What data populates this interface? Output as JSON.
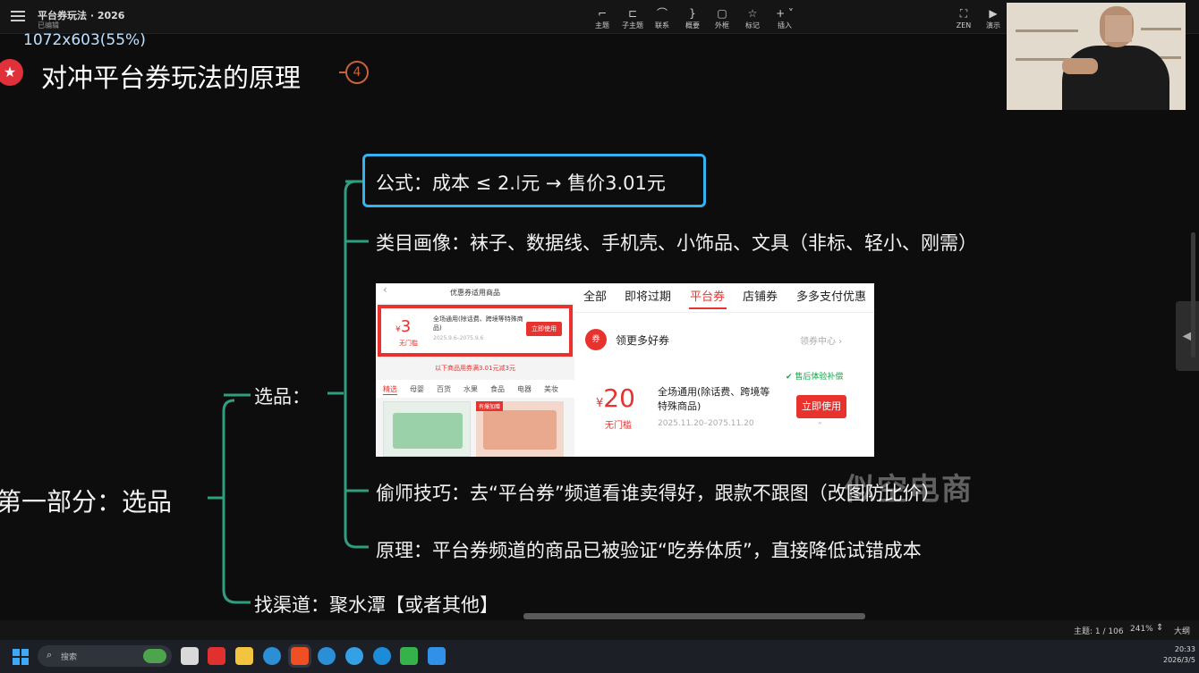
{
  "toolbar": {
    "doc_title": "平台券玩法 · 2026",
    "doc_status": "已编辑",
    "tools": [
      {
        "icon": "topic-icon",
        "glyph": "⌐",
        "label": "主题"
      },
      {
        "icon": "subtopic-icon",
        "glyph": "⊏",
        "label": "子主题"
      },
      {
        "icon": "relation-icon",
        "glyph": "⌒",
        "label": "联系"
      },
      {
        "icon": "summary-icon",
        "glyph": "}",
        "label": "概要"
      },
      {
        "icon": "boundary-icon",
        "glyph": "▢",
        "label": "外框"
      },
      {
        "icon": "marker-icon",
        "glyph": "☆",
        "label": "标记"
      },
      {
        "icon": "insert-icon",
        "glyph": "+ ˅",
        "label": "插入"
      }
    ],
    "zen": {
      "icon": "zen-icon",
      "glyph": "⛶",
      "label": "ZEN"
    },
    "present": {
      "icon": "present-icon",
      "glyph": "▶",
      "label": "演示"
    }
  },
  "resolution_label": "1072x603(55%)",
  "heading": {
    "badge_glyph": "★",
    "title": "对冲平台券玩法的原理",
    "count": "4"
  },
  "mindmap": {
    "root": "第一部分：选品",
    "branch1": "选品：",
    "branch2": "找渠道：聚水潭【或者其他】",
    "children": {
      "formula_prefix": "公式：成本 ≤ 2.",
      "formula_cursor": "I",
      "formula_suffix": "元 → 售价3.01元",
      "category": "类目画像：袜子、数据线、手机壳、小饰品、文具（非标、轻小、刚需）",
      "tip": "偷师技巧：去“平台券”频道看谁卖得好，跟款不跟图（改图防比价）",
      "principle": "原理：平台券频道的商品已被验证“吃券体质”，直接降低试错成本"
    }
  },
  "screenshot": {
    "left": {
      "header": "优惠券适用商品",
      "back_glyph": "‹",
      "coupon_symbol": "¥",
      "coupon_value": "3",
      "coupon_condition": "无门槛",
      "coupon_name": "全场通用(除话费、跨境等特殊商品)",
      "coupon_date": "2025.9.6–2075.9.6",
      "coupon_button": "立即使用",
      "note": "以下商品用券满3.01元减3元",
      "categories": [
        "精选",
        "母婴",
        "百货",
        "水果",
        "食品",
        "电器",
        "美妆"
      ],
      "product_tag": "有爆加赠"
    },
    "right": {
      "tabs": [
        "全部",
        "即将过期",
        "平台券",
        "店铺券",
        "多多支付优惠"
      ],
      "active_tab": "平台券",
      "more_icon_glyph": "券",
      "more_label": "领更多好券",
      "center_link": "领券中心 ›",
      "coupon_symbol": "¥",
      "coupon_value": "20",
      "coupon_condition": "无门槛",
      "coupon_name": "全场通用(除话费、跨境等特殊商品)",
      "coupon_date": "2025.11.20–2075.11.20",
      "guarantee": "售后体验补偿",
      "coupon_button": "立即使用",
      "chevron": "˅"
    }
  },
  "watermark": "似空电商",
  "side_handle_glyph": "◀",
  "status_bar": {
    "topic": "主题: 1 / 106",
    "zoom": "241%",
    "outline": "大纲"
  },
  "taskbar": {
    "search_placeholder": "搜索",
    "search_glyph": "⌕",
    "apps": [
      {
        "icon": "task-view-icon",
        "color": "#d9d9d9"
      },
      {
        "icon": "wps-icon",
        "color": "#e0302f"
      },
      {
        "icon": "file-explorer-icon",
        "color": "#f3c43d"
      },
      {
        "icon": "edge-icon",
        "color": "#2b8fd6"
      },
      {
        "icon": "xmind-icon",
        "color": "#f04e23"
      },
      {
        "icon": "edge-icon",
        "color": "#2b8fd6"
      },
      {
        "icon": "edge-icon",
        "color": "#34a0e6"
      },
      {
        "icon": "edge-icon",
        "color": "#1d8cd8"
      },
      {
        "icon": "wechat-devtools-icon",
        "color": "#35b34a"
      },
      {
        "icon": "screen-recorder-icon",
        "color": "#3190e8"
      }
    ],
    "time": "20:33",
    "date": "2026/3/5"
  },
  "colors": {
    "accent_blue": "#34b3f0",
    "branch_green": "#2f9e7e",
    "coupon_red": "#e8322e",
    "heading_red": "#e0303a"
  }
}
